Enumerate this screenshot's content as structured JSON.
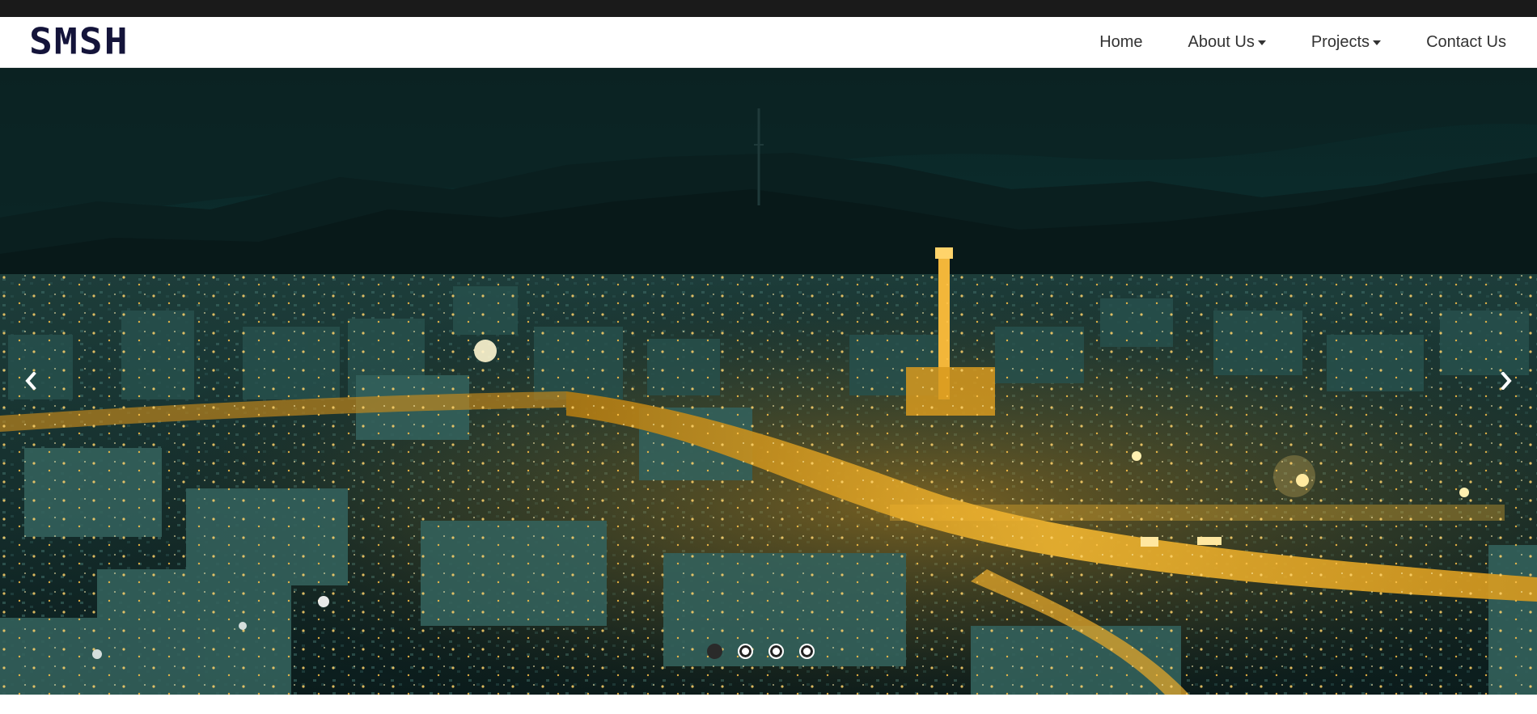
{
  "brand": {
    "logo_text": "SMSH"
  },
  "nav": {
    "items": [
      {
        "label": "Home",
        "has_dropdown": false
      },
      {
        "label": "About Us",
        "has_dropdown": true
      },
      {
        "label": "Projects",
        "has_dropdown": true
      },
      {
        "label": "Contact Us",
        "has_dropdown": false
      }
    ]
  },
  "carousel": {
    "slide_count": 4,
    "active_index": 0,
    "prev_icon": "chevron-left-icon",
    "next_icon": "chevron-right-icon"
  },
  "colors": {
    "top_bar": "#1a1a1a",
    "logo": "#14143a",
    "nav_text": "#333333",
    "sky": "#0c2e2e",
    "city_lights": "#f0b530"
  }
}
